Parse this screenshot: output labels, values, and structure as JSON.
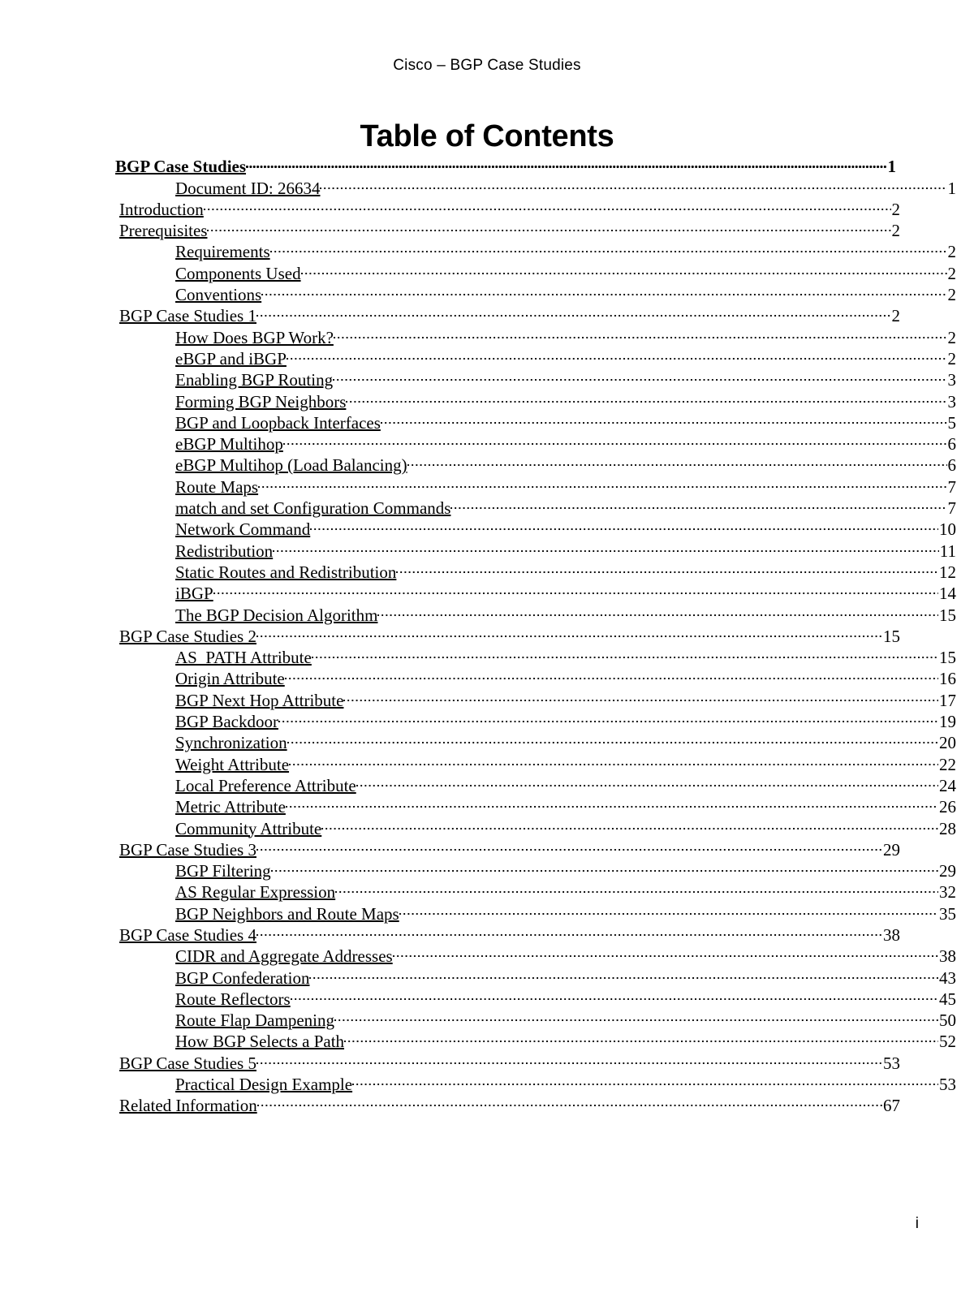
{
  "header": {
    "running_head": "Cisco – BGP Case Studies",
    "title": "Table of Contents"
  },
  "footer": {
    "page_number": "i"
  },
  "toc": {
    "entries": [
      {
        "label": "BGP Case Studies",
        "page": "1",
        "level": "bold"
      },
      {
        "label": "Document ID: 26634",
        "page": "1",
        "level": "sub"
      },
      {
        "label": " Introduction",
        "page": "2",
        "level": "main"
      },
      {
        "label": " Prerequisites",
        "page": "2",
        "level": "main"
      },
      {
        "label": " Requirements",
        "page": "2",
        "level": "sub"
      },
      {
        "label": " Components Used",
        "page": "2",
        "level": "sub"
      },
      {
        "label": " Conventions",
        "page": "2",
        "level": "sub"
      },
      {
        "label": " BGP Case Studies 1",
        "page": "2",
        "level": "main"
      },
      {
        "label": " How Does BGP Work?",
        "page": "2",
        "level": "sub"
      },
      {
        "label": " eBGP and iBGP",
        "page": "2",
        "level": "sub"
      },
      {
        "label": " Enabling BGP Routing",
        "page": "3",
        "level": "sub"
      },
      {
        "label": " Forming BGP Neighbors",
        "page": "3",
        "level": "sub"
      },
      {
        "label": " BGP and Loopback Interfaces",
        "page": "5",
        "level": "sub"
      },
      {
        "label": " eBGP Multihop",
        "page": "6",
        "level": "sub"
      },
      {
        "label": " eBGP Multihop (Load Balancing)",
        "page": "6",
        "level": "sub"
      },
      {
        "label": " Route Maps",
        "page": "7",
        "level": "sub"
      },
      {
        "label": " match and set Configuration Commands",
        "page": "7",
        "level": "sub"
      },
      {
        "label": " Network Command",
        "page": "10",
        "level": "sub"
      },
      {
        "label": " Redistribution",
        "page": "11",
        "level": "sub"
      },
      {
        "label": " Static Routes and Redistribution",
        "page": "12",
        "level": "sub"
      },
      {
        "label": " iBGP",
        "page": "14",
        "level": "sub"
      },
      {
        "label": " The BGP Decision Algorithm",
        "page": "15",
        "level": "sub"
      },
      {
        "label": " BGP Case Studies 2",
        "page": "15",
        "level": "main"
      },
      {
        "label": " AS_PATH Attribute",
        "page": "15",
        "level": "sub"
      },
      {
        "label": " Origin Attribute",
        "page": "16",
        "level": "sub"
      },
      {
        "label": " BGP Next Hop Attribute",
        "page": "17",
        "level": "sub"
      },
      {
        "label": " BGP Backdoor",
        "page": "19",
        "level": "sub"
      },
      {
        "label": " Synchronization",
        "page": "20",
        "level": "sub"
      },
      {
        "label": " Weight Attribute",
        "page": "22",
        "level": "sub"
      },
      {
        "label": " Local Preference Attribute",
        "page": "24",
        "level": "sub"
      },
      {
        "label": " Metric Attribute",
        "page": "26",
        "level": "sub"
      },
      {
        "label": " Community Attribute",
        "page": "28",
        "level": "sub"
      },
      {
        "label": " BGP Case Studies 3",
        "page": "29",
        "level": "main"
      },
      {
        "label": " BGP Filtering",
        "page": "29",
        "level": "sub"
      },
      {
        "label": " AS Regular Expression",
        "page": "32",
        "level": "sub"
      },
      {
        "label": " BGP Neighbors and Route Maps",
        "page": "35",
        "level": "sub"
      },
      {
        "label": " BGP Case Studies 4",
        "page": "38",
        "level": "main"
      },
      {
        "label": " CIDR and Aggregate Addresses",
        "page": "38",
        "level": "sub"
      },
      {
        "label": " BGP Confederation",
        "page": "43",
        "level": "sub"
      },
      {
        "label": " Route Reflectors",
        "page": "45",
        "level": "sub"
      },
      {
        "label": " Route Flap Dampening",
        "page": "50",
        "level": "sub"
      },
      {
        "label": " How BGP Selects a Path",
        "page": "52",
        "level": "sub"
      },
      {
        "label": " BGP Case Studies 5",
        "page": "53",
        "level": "main"
      },
      {
        "label": " Practical Design Example",
        "page": "53",
        "level": "sub"
      },
      {
        "label": " Related Information",
        "page": "67",
        "level": "main"
      }
    ]
  }
}
